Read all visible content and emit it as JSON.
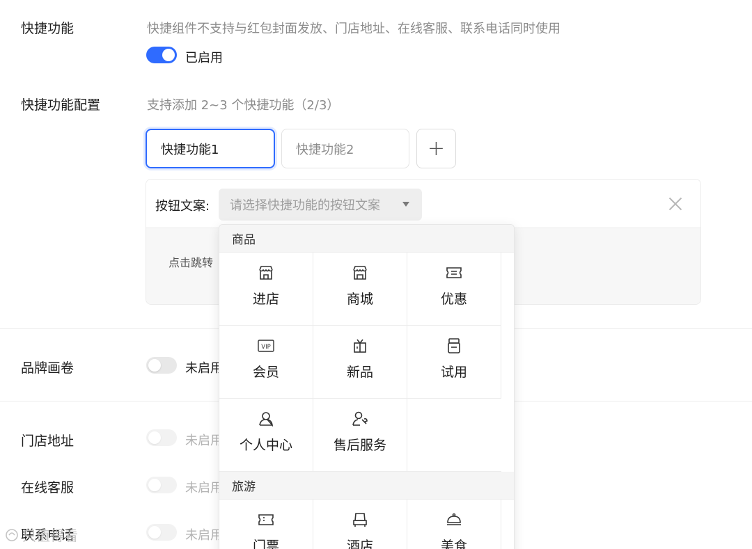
{
  "shortcut": {
    "label": "快捷功能",
    "hint": "快捷组件不支持与红包封面发放、门店地址、在线客服、联系电话同时使用",
    "toggle_state": "on",
    "toggle_label": "已启用"
  },
  "config": {
    "label": "快捷功能配置",
    "hint": "支持添加 2~3 个快捷功能（2/3）",
    "tabs": [
      {
        "label": "快捷功能1",
        "active": true
      },
      {
        "label": "快捷功能2",
        "active": false
      }
    ],
    "add_symbol": "+",
    "panel": {
      "field_label": "按钮文案:",
      "select_placeholder": "请选择快捷功能的按钮文案",
      "body_text": "点击跳转"
    }
  },
  "dropdown": {
    "groups": [
      {
        "title": "商品",
        "items": [
          {
            "label": "进店",
            "icon": "store-icon"
          },
          {
            "label": "商城",
            "icon": "mall-icon"
          },
          {
            "label": "优惠",
            "icon": "coupon-icon"
          },
          {
            "label": "会员",
            "icon": "vip-icon"
          },
          {
            "label": "新品",
            "icon": "gift-icon"
          },
          {
            "label": "试用",
            "icon": "trial-icon"
          },
          {
            "label": "个人中心",
            "icon": "user-icon"
          },
          {
            "label": "售后服务",
            "icon": "service-icon"
          }
        ]
      },
      {
        "title": "旅游",
        "items": [
          {
            "label": "门票",
            "icon": "ticket-icon"
          },
          {
            "label": "酒店",
            "icon": "hotel-icon"
          },
          {
            "label": "美食",
            "icon": "food-icon"
          }
        ]
      }
    ]
  },
  "brand": {
    "label": "品牌画卷",
    "toggle_state": "off",
    "toggle_label": "未启用"
  },
  "store_address": {
    "label": "门店地址",
    "toggle_state": "disabled",
    "toggle_label": "未启用"
  },
  "online_service": {
    "label": "在线客服",
    "toggle_state": "disabled",
    "toggle_label": "未启用"
  },
  "phone": {
    "label": "联系电话",
    "toggle_state": "disabled",
    "toggle_label": "未启用"
  },
  "watermark": "只值得看",
  "colors": {
    "accent": "#2f6bff",
    "muted": "#8c8c8c"
  }
}
